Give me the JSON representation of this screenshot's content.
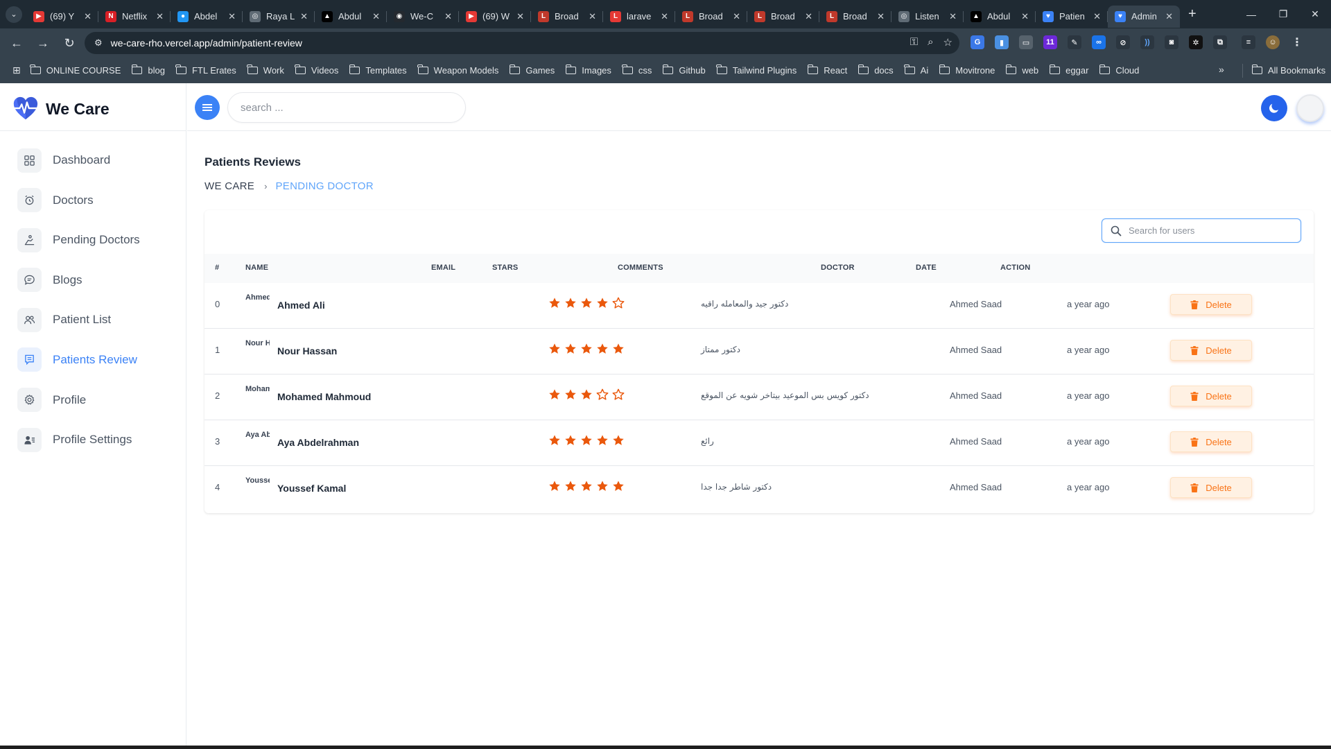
{
  "browser": {
    "tabs": [
      {
        "label": "(69) Y",
        "fav_color": "#e53935",
        "fav_glyph": "▶"
      },
      {
        "label": "Netflix",
        "fav_color": "#d81f26",
        "fav_glyph": "N"
      },
      {
        "label": "Abdel",
        "fav_color": "#2196f3",
        "fav_glyph": "●"
      },
      {
        "label": "Raya L",
        "fav_color": "#5f6b75",
        "fav_glyph": "◎"
      },
      {
        "label": "Abdul",
        "fav_color": "#000000",
        "fav_glyph": "▲"
      },
      {
        "label": "We-C",
        "fav_color": "#24292f",
        "fav_glyph": "◉"
      },
      {
        "label": "(69) W",
        "fav_color": "#e53935",
        "fav_glyph": "▶"
      },
      {
        "label": "Broad",
        "fav_color": "#c0392b",
        "fav_glyph": "L"
      },
      {
        "label": "larave",
        "fav_color": "#e53935",
        "fav_glyph": "L"
      },
      {
        "label": "Broad",
        "fav_color": "#c0392b",
        "fav_glyph": "L"
      },
      {
        "label": "Broad",
        "fav_color": "#c0392b",
        "fav_glyph": "L"
      },
      {
        "label": "Broad",
        "fav_color": "#c0392b",
        "fav_glyph": "L"
      },
      {
        "label": "Listen",
        "fav_color": "#5f6b75",
        "fav_glyph": "◎"
      },
      {
        "label": "Abdul",
        "fav_color": "#000000",
        "fav_glyph": "▲"
      },
      {
        "label": "Patien",
        "fav_color": "#3b82f6",
        "fav_glyph": "♥"
      },
      {
        "label": "Admin",
        "fav_color": "#3b82f6",
        "fav_glyph": "♥"
      }
    ],
    "url": "we-care-rho.vercel.app/admin/patient-review",
    "bookmarks": [
      "ONLINE COURSE",
      "blog",
      "FTL Erates",
      "Work",
      "Videos",
      "Templates",
      "Weapon Models",
      "Games",
      "Images",
      "css",
      "Github",
      "Tailwind Plugins",
      "React",
      "docs",
      "Ai",
      "Movitrone",
      "web",
      "eggar",
      "Cloud"
    ],
    "all_bookmarks": "All Bookmarks",
    "ext_badge": "11"
  },
  "app": {
    "brand": "We Care",
    "accent": "#3b82f6",
    "search_placeholder": "search ...",
    "nav": [
      {
        "label": "Dashboard",
        "icon": "grid-icon"
      },
      {
        "label": "Doctors",
        "icon": "alarm-clock-icon"
      },
      {
        "label": "Pending Doctors",
        "icon": "hourglass-person-icon"
      },
      {
        "label": "Blogs",
        "icon": "chat-bubble-icon"
      },
      {
        "label": "Patient List",
        "icon": "users-icon"
      },
      {
        "label": "Patients Review",
        "icon": "review-icon",
        "active": true
      },
      {
        "label": "Profile",
        "icon": "gear-icon"
      },
      {
        "label": "Profile Settings",
        "icon": "user-settings-icon"
      }
    ]
  },
  "page": {
    "title": "Patients Reviews",
    "breadcrumb_root": "WE CARE",
    "breadcrumb_sep": "›",
    "breadcrumb_current": "PENDING DOCTOR",
    "user_search_placeholder": "Search for users"
  },
  "table": {
    "columns": [
      "#",
      "NAME",
      "EMAIL",
      "STARS",
      "COMMENTS",
      "DOCTOR",
      "DATE",
      "ACTION"
    ],
    "action_label": "Delete",
    "star_color": "#ea580c",
    "rows": [
      {
        "index": "0",
        "avatar_alt": "Ahmed Ali",
        "name": "Ahmed Ali",
        "email": "",
        "stars": 4,
        "comment": "دكتور جيد والمعامله راقيه",
        "doctor": "Ahmed Saad",
        "date": "a year ago"
      },
      {
        "index": "1",
        "avatar_alt": "Nour Hassan",
        "name": "Nour Hassan",
        "email": "",
        "stars": 5,
        "comment": "دكتور ممتاز",
        "doctor": "Ahmed Saad",
        "date": "a year ago"
      },
      {
        "index": "2",
        "avatar_alt": "Mohamed Mahmoud",
        "name": "Mohamed Mahmoud",
        "email": "",
        "stars": 3,
        "comment": "دكتور كويس بس الموعيد بيتاخر شويه عن الموقع",
        "doctor": "Ahmed Saad",
        "date": "a year ago"
      },
      {
        "index": "3",
        "avatar_alt": "Aya Abdelrahman",
        "name": "Aya Abdelrahman",
        "email": "",
        "stars": 5,
        "comment": "رائع",
        "doctor": "Ahmed Saad",
        "date": "a year ago"
      },
      {
        "index": "4",
        "avatar_alt": "Youssef Kamal",
        "name": "Youssef Kamal",
        "email": "",
        "stars": 5,
        "comment": "دكتور شاطر جدا جدا",
        "doctor": "Ahmed Saad",
        "date": "a year ago"
      }
    ]
  }
}
